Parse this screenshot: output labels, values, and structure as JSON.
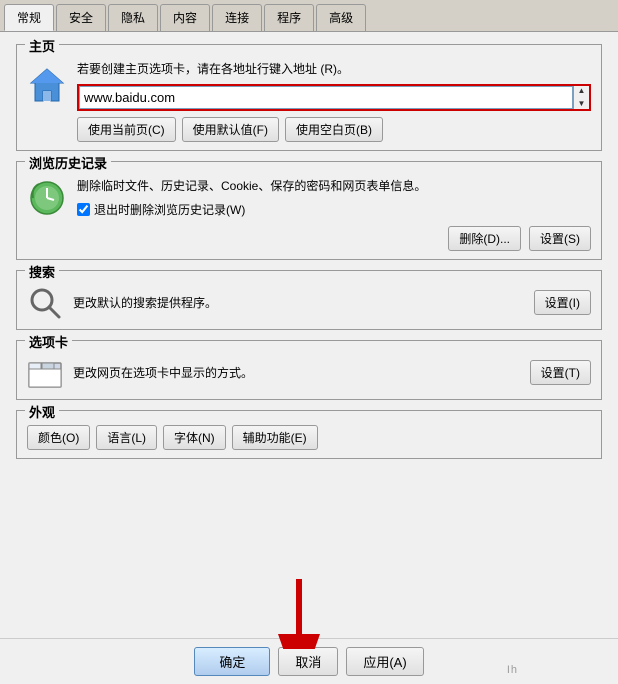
{
  "tabs": {
    "items": [
      {
        "label": "常规",
        "active": true
      },
      {
        "label": "安全",
        "active": false
      },
      {
        "label": "隐私",
        "active": false
      },
      {
        "label": "内容",
        "active": false
      },
      {
        "label": "连接",
        "active": false
      },
      {
        "label": "程序",
        "active": false
      },
      {
        "label": "高级",
        "active": false
      }
    ]
  },
  "homepage": {
    "section_title": "主页",
    "description": "若要创建主页选项卡，请在各地址行键入地址 (R)。",
    "url_value": "www.baidu.com",
    "btn_current": "使用当前页(C)",
    "btn_default": "使用默认值(F)",
    "btn_blank": "使用空白页(B)"
  },
  "history": {
    "section_title": "浏览历史记录",
    "description": "删除临时文件、历史记录、Cookie、保存的密码和网页表单信息。",
    "checkbox_label": "退出时删除浏览历史记录(W)",
    "checkbox_checked": true,
    "btn_delete": "删除(D)...",
    "btn_settings": "设置(S)"
  },
  "search": {
    "section_title": "搜索",
    "description": "更改默认的搜索提供程序。",
    "btn_settings": "设置(I)"
  },
  "tabs_section": {
    "section_title": "选项卡",
    "description": "更改网页在选项卡中显示的方式。",
    "btn_settings": "设置(T)"
  },
  "appearance": {
    "section_title": "外观",
    "btn_colors": "颜色(O)",
    "btn_language": "语言(L)",
    "btn_fonts": "字体(N)",
    "btn_accessibility": "辅助功能(E)"
  },
  "bottom": {
    "btn_ok": "确定",
    "btn_cancel": "取消",
    "btn_apply": "应用(A)"
  },
  "watermark": {
    "text": "Ih"
  }
}
